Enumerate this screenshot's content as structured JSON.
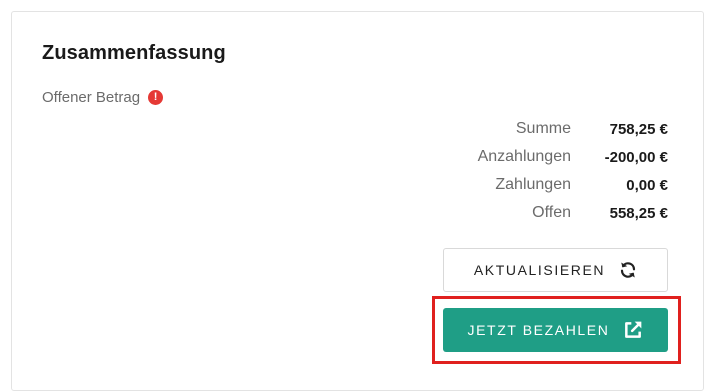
{
  "summary": {
    "title": "Zusammenfassung",
    "subtitle": "Offener Betrag",
    "alert_icon": "exclamation-circle-icon",
    "rows": [
      {
        "label": "Summe",
        "value": "758,25 €"
      },
      {
        "label": "Anzahlungen",
        "value": "-200,00 €"
      },
      {
        "label": "Zahlungen",
        "value": "0,00 €"
      },
      {
        "label": "Offen",
        "value": "558,25 €"
      }
    ]
  },
  "buttons": {
    "refresh": {
      "label": "AKTUALISIEREN",
      "icon": "refresh-icon"
    },
    "pay": {
      "label": "JETZT BEZAHLEN",
      "icon": "external-link-icon",
      "color": "#1f9e86"
    }
  },
  "highlight_color": "#e0201e",
  "alert_color": "#e53935"
}
